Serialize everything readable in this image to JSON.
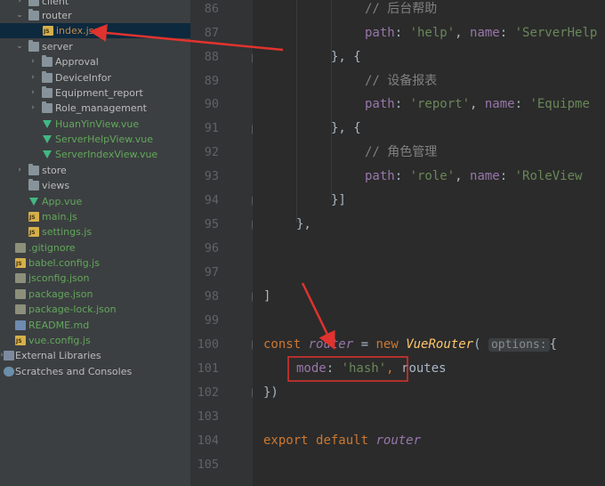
{
  "colors": {
    "accent_red": "#e0332e",
    "selection": "#0d293e"
  },
  "sidebar": {
    "items": [
      {
        "label": "client",
        "icon": "folder-icon",
        "style": ""
      },
      {
        "label": "router",
        "icon": "folder-icon",
        "style": ""
      },
      {
        "label": "index.js",
        "icon": "js-file-icon",
        "style": "orange"
      },
      {
        "label": "server",
        "icon": "folder-icon",
        "style": ""
      },
      {
        "label": "Approval",
        "icon": "folder-icon",
        "style": ""
      },
      {
        "label": "DeviceInfor",
        "icon": "folder-icon",
        "style": ""
      },
      {
        "label": "Equipment_report",
        "icon": "folder-icon",
        "style": ""
      },
      {
        "label": "Role_management",
        "icon": "folder-icon",
        "style": ""
      },
      {
        "label": "HuanYinView.vue",
        "icon": "vue-file-icon",
        "style": "green"
      },
      {
        "label": "ServerHelpView.vue",
        "icon": "vue-file-icon",
        "style": "green"
      },
      {
        "label": "ServerIndexView.vue",
        "icon": "vue-file-icon",
        "style": "green"
      },
      {
        "label": "store",
        "icon": "folder-icon",
        "style": ""
      },
      {
        "label": "views",
        "icon": "folder-icon",
        "style": ""
      },
      {
        "label": "App.vue",
        "icon": "vue-file-icon",
        "style": "green"
      },
      {
        "label": "main.js",
        "icon": "js-file-icon",
        "style": "green"
      },
      {
        "label": "settings.js",
        "icon": "js-file-icon",
        "style": "green"
      },
      {
        "label": ".gitignore",
        "icon": "file-icon",
        "style": "green"
      },
      {
        "label": "babel.config.js",
        "icon": "js-file-icon",
        "style": "green"
      },
      {
        "label": "jsconfig.json",
        "icon": "json-file-icon",
        "style": "green"
      },
      {
        "label": "package.json",
        "icon": "json-file-icon",
        "style": "green"
      },
      {
        "label": "package-lock.json",
        "icon": "json-file-icon",
        "style": "green"
      },
      {
        "label": "README.md",
        "icon": "md-file-icon",
        "style": "green"
      },
      {
        "label": "vue.config.js",
        "icon": "js-file-icon",
        "style": "green"
      },
      {
        "label": "External Libraries",
        "icon": "library-icon",
        "style": ""
      },
      {
        "label": "Scratches and Consoles",
        "icon": "scratch-icon",
        "style": ""
      }
    ]
  },
  "editor": {
    "line_numbers": [
      "86",
      "87",
      "88",
      "89",
      "90",
      "91",
      "92",
      "93",
      "94",
      "95",
      "96",
      "97",
      "98",
      "99",
      "100",
      "101",
      "102",
      "103",
      "104",
      "105"
    ],
    "code": {
      "l86_comment": "// 后台帮助",
      "l87_path_key": "path",
      "l87_colon": ": ",
      "l87_path_val": "'help'",
      "l87_sep": ", ",
      "l87_name_key": "name",
      "l87_name_val": "'ServerHelp",
      "l88": "}, {",
      "l89_comment": "// 设备报表",
      "l90_path_key": "path",
      "l90_colon": ": ",
      "l90_path_val": "'report'",
      "l90_sep": ", ",
      "l90_name_key": "name",
      "l90_name_val": "'Equipme",
      "l91": "}, {",
      "l92_comment": "// 角色管理",
      "l93_path_key": "path",
      "l93_colon": ": ",
      "l93_path_val": "'role'",
      "l93_sep": ", ",
      "l93_name_key": "name",
      "l93_name_val": "'RoleView",
      "l94": "}]",
      "l95": "},",
      "l98": "]",
      "l100_const": "const",
      "l100_router": "router",
      "l100_eq": " = ",
      "l100_new": "new",
      "l100_class": "VueRouter",
      "l100_paren": "(",
      "l100_hint": "options:",
      "l100_brace": "{",
      "l101_mode_key": "mode",
      "l101_colon": ": ",
      "l101_mode_val": "'hash'",
      "l101_comma": ",",
      "l101_routes": " routes",
      "l102": "})",
      "l104_export": "export",
      "l104_default": "default",
      "l104_router": "router"
    }
  }
}
